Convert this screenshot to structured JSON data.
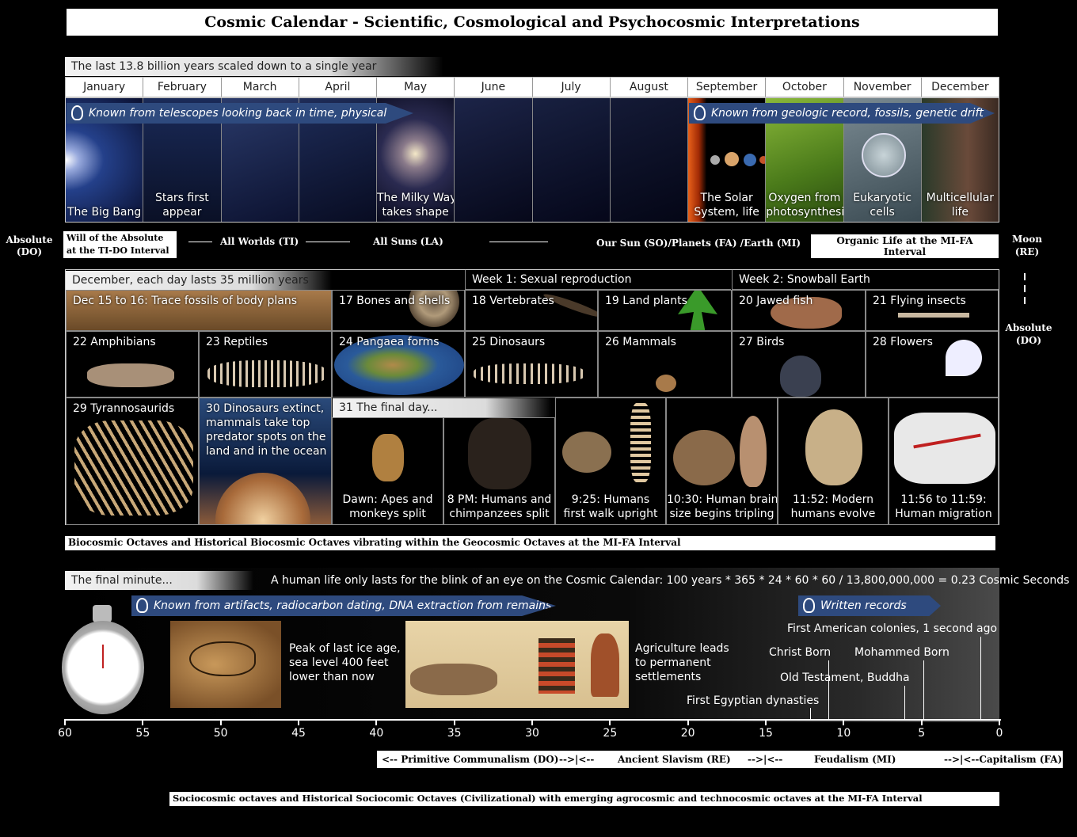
{
  "title": "Cosmic Calendar - Scientific, Cosmological and Psychocosmic Interpretations",
  "year_banner": "The last 13.8 billion years scaled down to a single year",
  "months": [
    "January",
    "February",
    "March",
    "April",
    "May",
    "June",
    "July",
    "August",
    "September",
    "October",
    "November",
    "December"
  ],
  "telescope_banner": "Known from telescopes looking back in time, physical models",
  "geologic_banner": "Known from geologic record, fossils, genetic drift",
  "month_captions": {
    "jan": "The Big Bang",
    "feb": "Stars first appear",
    "may": "The Milky Way\ntakes shape",
    "sep": "The Solar\nSystem, life",
    "oct": "Oxygen from\nphotosynthesis",
    "nov": "Eukaryotic\ncells",
    "dec": "Multicellular\nlife"
  },
  "octaves_row": {
    "absolute_left": "Absolute\n(DO)",
    "will": "Will of the Absolute\nat the TI-DO Interval",
    "all_worlds": "All Worlds (TI)",
    "all_suns": "All Suns (LA)",
    "our_sun": "Our Sun (SO)/Planets (FA) /Earth (MI)",
    "organic": "Organic Life at the MI-FA Interval",
    "moon": "Moon\n(RE)",
    "absolute_right": "Absolute\n(DO)"
  },
  "december": {
    "banner": "December, each day lasts 35 million years",
    "week1": "Week 1: Sexual reproduction",
    "week2": "Week 2: Snowball Earth",
    "row1": [
      "Dec 15 to 16: Trace fossils of body plans",
      "17 Bones and shells",
      "18 Vertebrates",
      "19 Land plants",
      "20 Jawed fish",
      "21 Flying insects"
    ],
    "row2": [
      "22 Amphibians",
      "23 Reptiles",
      "24 Pangaea forms",
      "25 Dinosaurs",
      "26 Mammals",
      "27 Birds",
      "28 Flowers"
    ],
    "row3_left": [
      "29 Tyrannosaurids",
      "30 Dinosaurs extinct,\nmammals take top\npredator spots on the\nland and in the ocean"
    ],
    "final_day": "31 The final day...",
    "row3_final": [
      "Dawn: Apes and\nmonkeys split",
      "8 PM: Humans and\nchimpanzees split",
      "9:25: Humans\nfirst walk upright",
      "10:30: Human brain\nsize begins tripling",
      "11:52: Modern\nhumans evolve",
      "11:56 to 11:59:\nHuman migration"
    ]
  },
  "biocosmic": "Biocosmic Octaves and Historical Biocosmic Octaves vibrating within the Geocosmic Octaves  at the MI-FA Interval",
  "final_minute": {
    "banner": "The final minute...",
    "human_life": "A human life only lasts for the blink of an eye on the Cosmic Calendar: 100 years * 365 * 24 * 60 * 60  / 13,800,000,000 = 0.23 Cosmic Seconds",
    "artifacts_banner": "Known from artifacts, radiocarbon dating, DNA extraction from remains",
    "written_banner": "Written records",
    "ice_age": "Peak of last ice age,\nsea level 400 feet\nlower than now",
    "agriculture": "Agriculture leads\nto permanent\nsettlements",
    "american": "First American colonies, 1 second ago",
    "christ": "Christ Born",
    "mohammed": "Mohammed Born",
    "old_testament": "Old Testament, Buddha",
    "egyptian": "First Egyptian dynasties",
    "ticks": [
      "60",
      "55",
      "50",
      "45",
      "40",
      "35",
      "30",
      "25",
      "20",
      "15",
      "10",
      "5",
      "0"
    ]
  },
  "eras": {
    "primitive": "<-- Primitive Communalism (DO)",
    "sep1": "-->|<--",
    "ancient": "Ancient Slavism (RE)",
    "sep2": "-->|<--",
    "feudalism": "Feudalism (MI)",
    "capitalism": "-->|<--Capitalism (FA)"
  },
  "sociocosmic": "Sociocosmic octaves and Historical Sociocomic Octaves (Civilizational) with emerging agrocosmic and technocosmic octaves at the MI-FA Interval",
  "colors": {
    "banner_blue": "#2e4a7e",
    "sun": "#e8611a",
    "green": "#6a9a2a",
    "sky": "#1a2040"
  }
}
